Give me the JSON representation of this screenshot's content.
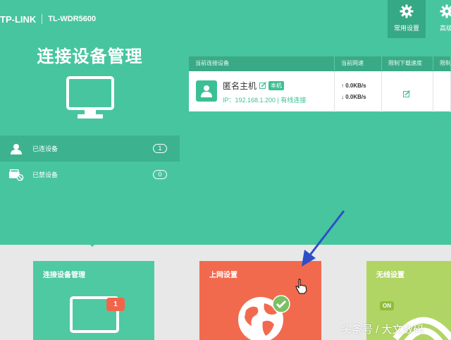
{
  "brand": {
    "logo": "TP-LINK",
    "model": "TL-WDR5600"
  },
  "page_title": "连接设备管理",
  "left_nav": {
    "items": [
      {
        "label": "已连设备",
        "count": "1",
        "icon": "user-icon",
        "active": true
      },
      {
        "label": "已禁设备",
        "count": "0",
        "icon": "blocked-device-icon",
        "active": false
      }
    ]
  },
  "toolbar": {
    "buttons": [
      {
        "label": "常用设置",
        "icon": "gear-icon",
        "active": true
      },
      {
        "label": "高级",
        "icon": "gear-icon",
        "active": false
      }
    ]
  },
  "device_table": {
    "headers": [
      "当前连接设备",
      "当前网速",
      "限制下载速度",
      "限制"
    ],
    "rows": [
      {
        "name": "匿名主机",
        "tag": "本机",
        "ip": "IP：192.168.1.200 | 有线连接",
        "up_speed": "↑ 0.0KB/s",
        "down_speed": "↓ 0.0KB/s"
      }
    ]
  },
  "cards": [
    {
      "title": "连接设备管理",
      "badge": "1",
      "color": "#4ec9a2"
    },
    {
      "title": "上网设置",
      "color": "#f26a4e"
    },
    {
      "title": "无线设置",
      "status": "ON",
      "color": "#b1d564"
    }
  ],
  "watermark": "头条号 / 大文数码",
  "colors": {
    "accent": "#47c59e",
    "accent_dark": "#3aa986",
    "orange": "#f26a4e",
    "lime": "#b1d564"
  }
}
